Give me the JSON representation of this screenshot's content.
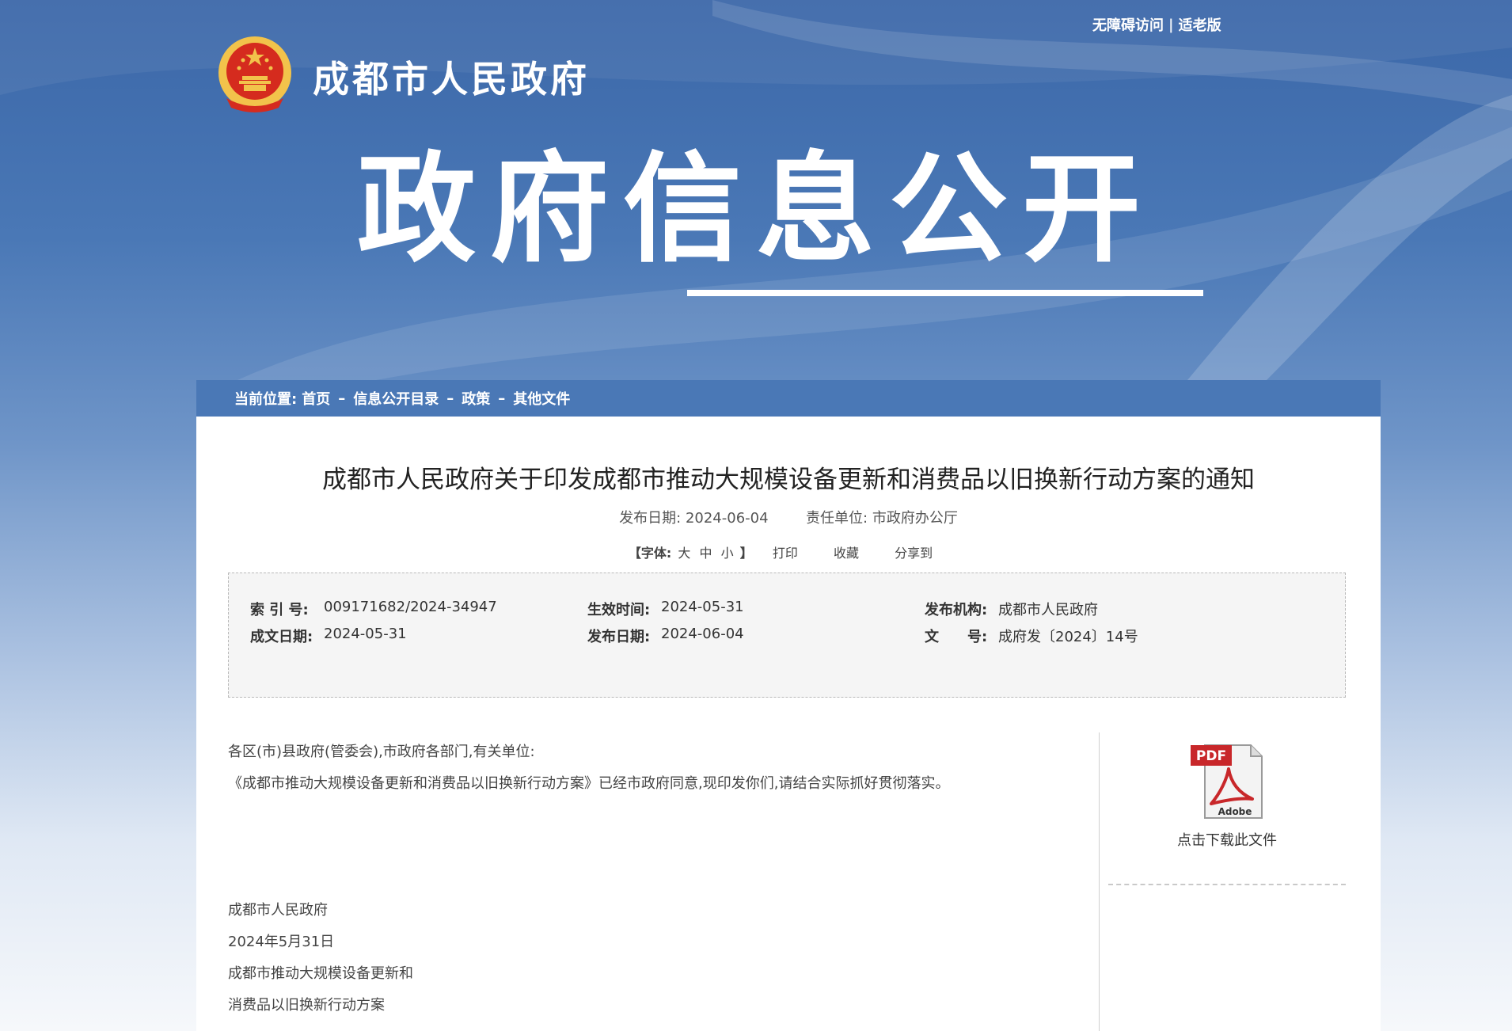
{
  "header": {
    "links": [
      "无障碍访问",
      "适老版"
    ],
    "separator": "|",
    "site_name": "成都市人民政府",
    "hero_title": "政府信息公开"
  },
  "breadcrumb": {
    "prefix": "当前位置:",
    "items": [
      "首页",
      "信息公开目录",
      "政策",
      "其他文件"
    ],
    "separator": "–"
  },
  "document": {
    "title": "成都市人民政府关于印发成都市推动大规模设备更新和消费品以旧换新行动方案的通知",
    "publish_label": "发布日期:",
    "publish_date": "2024-06-04",
    "unit_label": "责任单位:",
    "unit": "市政府办公厅",
    "font_label": "【字体:",
    "font_sizes": [
      "大",
      "中",
      "小"
    ],
    "font_close": "】",
    "actions": [
      "打印",
      "收藏",
      "分享到"
    ]
  },
  "info": {
    "index_label": "索 引 号:",
    "index_value": "009171682/2024-34947",
    "effective_label": "生效时间:",
    "effective_value": "2024-05-31",
    "issuer_label": "发布机构:",
    "issuer_value": "成都市人民政府",
    "written_label": "成文日期:",
    "written_value": "2024-05-31",
    "pubdate_label": "发布日期:",
    "pubdate_value": "2024-06-04",
    "docno_label": "文　　号:",
    "docno_value": "成府发〔2024〕14号"
  },
  "body": {
    "salutation": "各区(市)县政府(管委会),市政府各部门,有关单位:",
    "paragraph": "《成都市推动大规模设备更新和消费品以旧换新行动方案》已经市政府同意,现印发你们,请结合实际抓好贯彻落实。",
    "signature": "成都市人民政府",
    "date": "2024年5月31日",
    "attachment_line1": "成都市推动大规模设备更新和",
    "attachment_line2": "消费品以旧换新行动方案"
  },
  "download": {
    "pdf_badge": "PDF",
    "adobe_text": "Adobe",
    "label": "点击下载此文件"
  },
  "colors": {
    "banner_blue": "#3b67a8",
    "crumb_blue": "#4a78b6",
    "pdf_red": "#c8272a",
    "emblem_red": "#d52b1e",
    "emblem_gold": "#f2c34b"
  }
}
